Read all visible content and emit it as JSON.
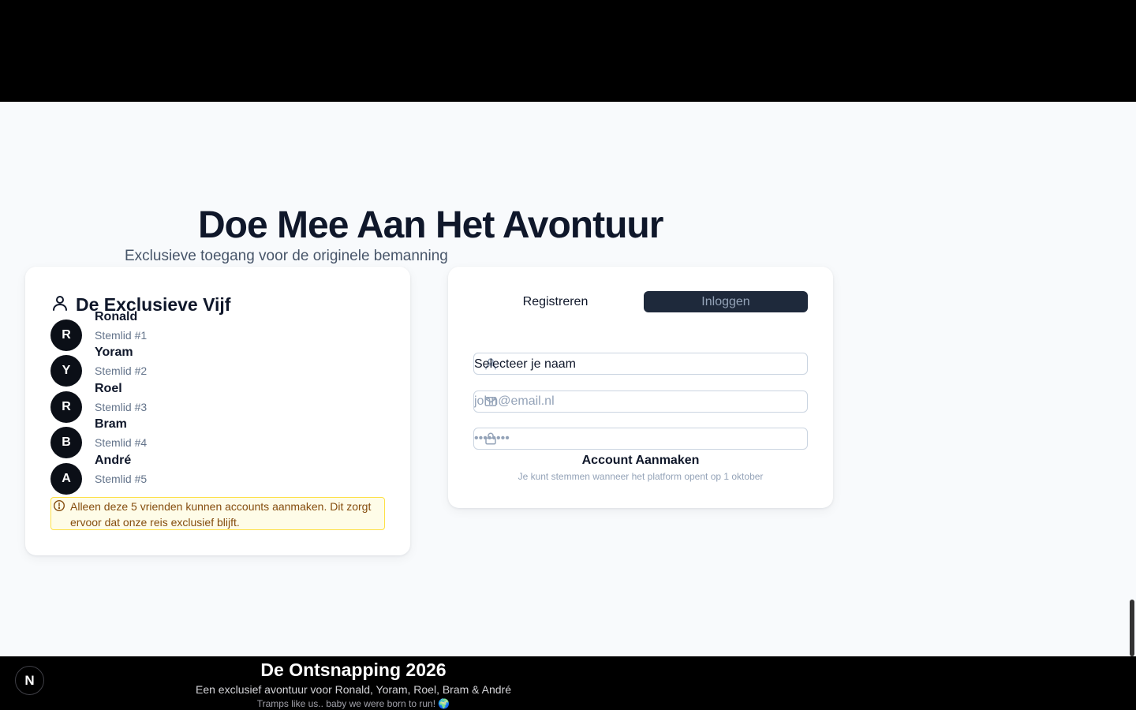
{
  "hero": {
    "title": "Doe Mee Aan Het Avontuur",
    "subtitle": "Exclusieve toegang voor de originele bemanning"
  },
  "crew": {
    "title": "De Exclusieve Vijf",
    "icon": "user-icon",
    "members": [
      {
        "initial": "R",
        "name": "Ronald",
        "role": "Stemlid #1"
      },
      {
        "initial": "Y",
        "name": "Yoram",
        "role": "Stemlid #2"
      },
      {
        "initial": "R",
        "name": "Roel",
        "role": "Stemlid #3"
      },
      {
        "initial": "B",
        "name": "Bram",
        "role": "Stemlid #4"
      },
      {
        "initial": "A",
        "name": "André",
        "role": "Stemlid #5"
      }
    ],
    "notice": "Alleen deze 5 vrienden kunnen accounts aanmaken. Dit zorgt ervoor dat onze reis exclusief blijft."
  },
  "auth": {
    "tabs": {
      "register": "Registreren",
      "login": "Inloggen"
    },
    "name_select": {
      "value": "Selecteer je naam",
      "icon": "user-icon"
    },
    "email": {
      "placeholder": "john@email.nl",
      "icon": "mail-icon"
    },
    "password": {
      "placeholder": "••••••••",
      "icon": "lock-icon"
    },
    "submit_label": "Account Aanmaken",
    "hint": "Je kunt stemmen wanneer het platform opent op 1 oktober"
  },
  "footer": {
    "badge": "N",
    "title": "De Ontsnapping 2026",
    "subtitle": "Een exclusief avontuur voor Ronald, Yoram, Roel, Bram & André",
    "tagline": "Tramps like us.. baby we were born to run! 🌍"
  },
  "colors": {
    "primary_dark": "#1e293b",
    "notice_bg": "#fefce8",
    "notice_border": "#fde047",
    "notice_text": "#854d0e"
  }
}
